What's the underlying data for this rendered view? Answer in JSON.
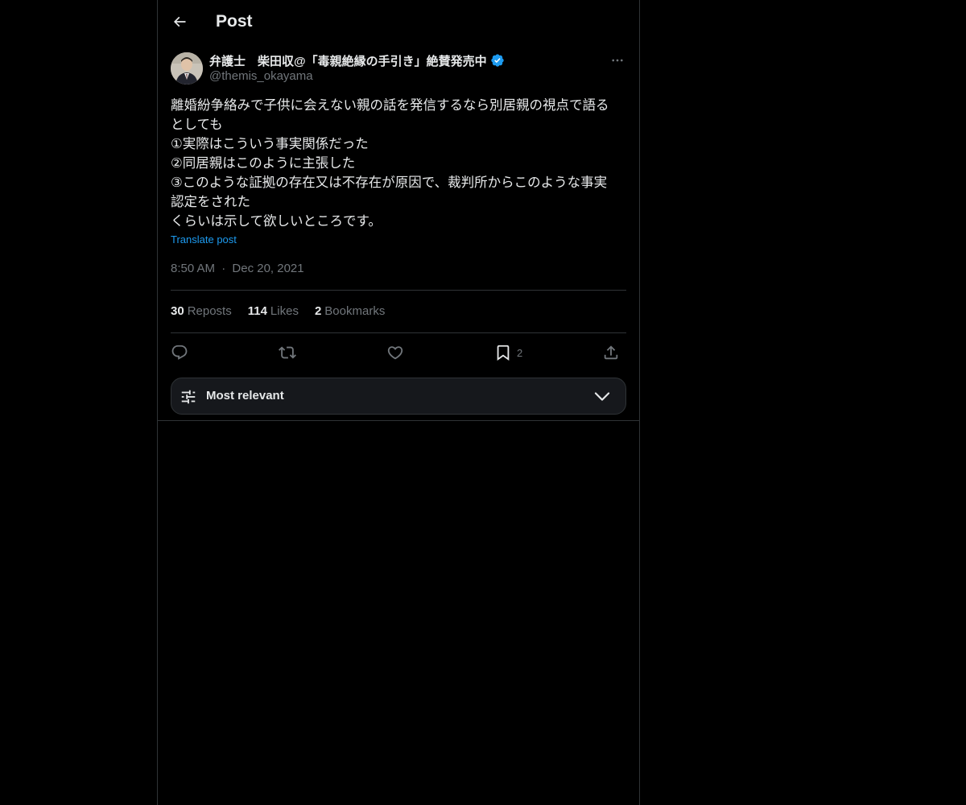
{
  "header": {
    "title": "Post"
  },
  "author": {
    "name": "弁護士　柴田収@「毒親絶縁の手引き」絶賛発売中",
    "handle": "@themis_okayama"
  },
  "post": {
    "lines": [
      "離婚紛争絡みで子供に会えない親の話を発信するなら別居親の視点で語る",
      "としても",
      "①実際はこういう事実関係だった",
      "②同居親はこのように主張した",
      "③このような証拠の存在又は不存在が原因で、裁判所からこのような事実",
      "認定をされた",
      "くらいは示して欲しいところです。"
    ],
    "translate_label": "Translate post",
    "time": "8:50 AM",
    "separator": "·",
    "date": "Dec 20, 2021"
  },
  "stats": {
    "reposts_count": "30",
    "reposts_label": "Reposts",
    "likes_count": "114",
    "likes_label": "Likes",
    "bookmarks_count": "2",
    "bookmarks_label": "Bookmarks"
  },
  "actions": {
    "bookmark_count": "2"
  },
  "sort": {
    "label": "Most relevant"
  },
  "colors": {
    "background": "#000000",
    "text": "#e7e9ea",
    "muted": "#71767b",
    "accent": "#1d9bf0",
    "border": "#2f3336"
  },
  "icons": {
    "back": "arrow-left-icon",
    "verified": "verified-badge-icon",
    "more": "more-horizontal-icon",
    "reply": "reply-icon",
    "repost": "repost-icon",
    "like": "heart-icon",
    "bookmark": "bookmark-icon",
    "share": "share-icon",
    "sort": "sliders-icon",
    "chevron": "chevron-down-icon"
  }
}
